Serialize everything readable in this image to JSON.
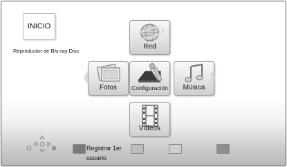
{
  "home": {
    "title": "INICIO",
    "subtitle": "Reproductor de Blu-ray Disc"
  },
  "menu": {
    "network": "Red",
    "photos": "Fotos",
    "settings": "Configuración",
    "music": "Música",
    "videos": "Vídeos"
  },
  "footer": {
    "red_button_label_line1": "Registrar 1er",
    "red_button_label_line2": "usuario"
  },
  "colors": {
    "red_button": "#7a7a7a",
    "green_button": "#bdbdbd",
    "yellow_button": "#cfcfcf",
    "blue_button": "#8e8e8e"
  }
}
